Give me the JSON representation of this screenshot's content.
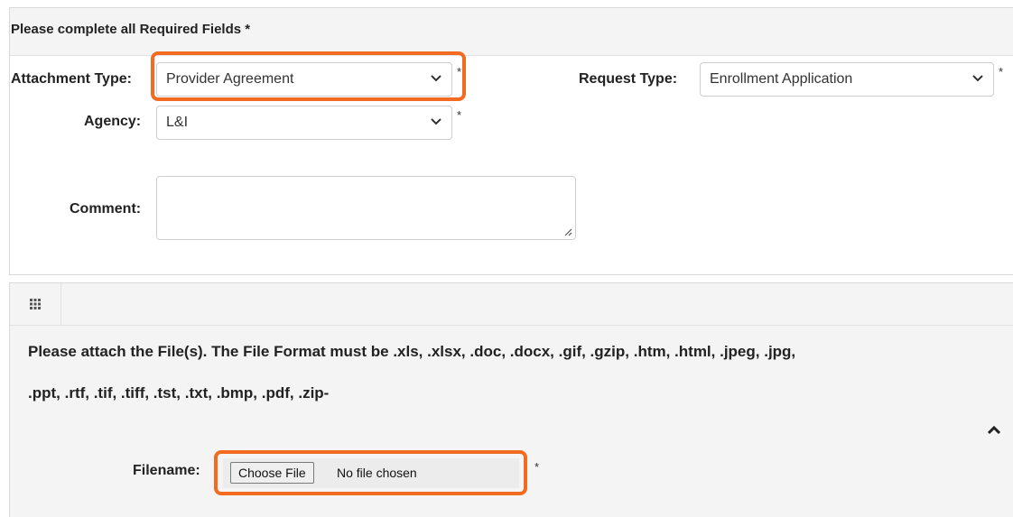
{
  "form": {
    "title": "Please complete all Required Fields *",
    "required_mark": "*",
    "attachment_type": {
      "label": "Attachment Type:",
      "value": "Provider Agreement"
    },
    "request_type": {
      "label": "Request Type:",
      "value": "Enrollment Application"
    },
    "agency": {
      "label": "Agency:",
      "value": "L&I"
    },
    "comment": {
      "label": "Comment:",
      "value": ""
    }
  },
  "upload": {
    "instruction_line1": "Please attach the File(s). The File Format must be .xls, .xlsx, .doc, .docx, .gif, .gzip, .htm, .html, .jpeg, .jpg,",
    "instruction_line2": ".ppt, .rtf, .tif, .tiff, .tst, .txt, .bmp, .pdf, .zip-",
    "filename_label": "Filename:",
    "choose_button": "Choose File",
    "no_file_text": "No file chosen"
  },
  "colors": {
    "highlight": "#f26b21",
    "header_bg": "#f4f4f4"
  },
  "icons": [
    "chevron-down-icon",
    "grid-icon",
    "chevron-up-icon",
    "resize-grip-icon"
  ]
}
